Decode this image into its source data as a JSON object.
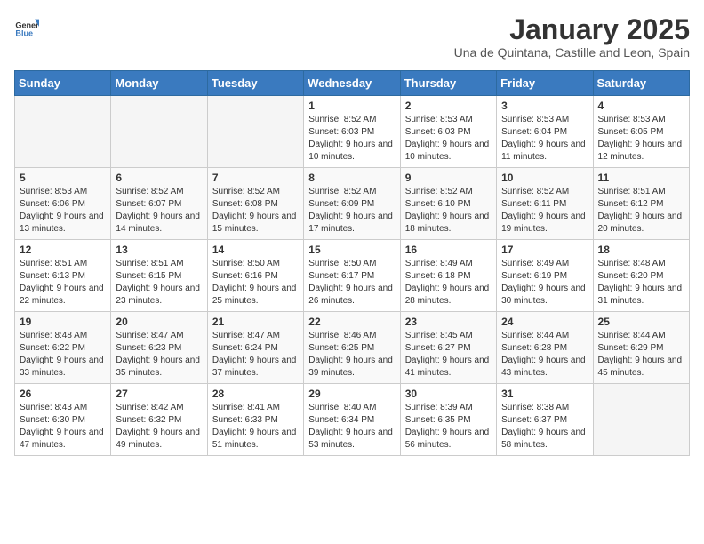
{
  "header": {
    "logo_general": "General",
    "logo_blue": "Blue",
    "title": "January 2025",
    "subtitle": "Una de Quintana, Castille and Leon, Spain"
  },
  "days_of_week": [
    "Sunday",
    "Monday",
    "Tuesday",
    "Wednesday",
    "Thursday",
    "Friday",
    "Saturday"
  ],
  "weeks": [
    [
      {
        "day": "",
        "info": ""
      },
      {
        "day": "",
        "info": ""
      },
      {
        "day": "",
        "info": ""
      },
      {
        "day": "1",
        "info": "Sunrise: 8:52 AM\nSunset: 6:03 PM\nDaylight: 9 hours and 10 minutes."
      },
      {
        "day": "2",
        "info": "Sunrise: 8:53 AM\nSunset: 6:03 PM\nDaylight: 9 hours and 10 minutes."
      },
      {
        "day": "3",
        "info": "Sunrise: 8:53 AM\nSunset: 6:04 PM\nDaylight: 9 hours and 11 minutes."
      },
      {
        "day": "4",
        "info": "Sunrise: 8:53 AM\nSunset: 6:05 PM\nDaylight: 9 hours and 12 minutes."
      }
    ],
    [
      {
        "day": "5",
        "info": "Sunrise: 8:53 AM\nSunset: 6:06 PM\nDaylight: 9 hours and 13 minutes."
      },
      {
        "day": "6",
        "info": "Sunrise: 8:52 AM\nSunset: 6:07 PM\nDaylight: 9 hours and 14 minutes."
      },
      {
        "day": "7",
        "info": "Sunrise: 8:52 AM\nSunset: 6:08 PM\nDaylight: 9 hours and 15 minutes."
      },
      {
        "day": "8",
        "info": "Sunrise: 8:52 AM\nSunset: 6:09 PM\nDaylight: 9 hours and 17 minutes."
      },
      {
        "day": "9",
        "info": "Sunrise: 8:52 AM\nSunset: 6:10 PM\nDaylight: 9 hours and 18 minutes."
      },
      {
        "day": "10",
        "info": "Sunrise: 8:52 AM\nSunset: 6:11 PM\nDaylight: 9 hours and 19 minutes."
      },
      {
        "day": "11",
        "info": "Sunrise: 8:51 AM\nSunset: 6:12 PM\nDaylight: 9 hours and 20 minutes."
      }
    ],
    [
      {
        "day": "12",
        "info": "Sunrise: 8:51 AM\nSunset: 6:13 PM\nDaylight: 9 hours and 22 minutes."
      },
      {
        "day": "13",
        "info": "Sunrise: 8:51 AM\nSunset: 6:15 PM\nDaylight: 9 hours and 23 minutes."
      },
      {
        "day": "14",
        "info": "Sunrise: 8:50 AM\nSunset: 6:16 PM\nDaylight: 9 hours and 25 minutes."
      },
      {
        "day": "15",
        "info": "Sunrise: 8:50 AM\nSunset: 6:17 PM\nDaylight: 9 hours and 26 minutes."
      },
      {
        "day": "16",
        "info": "Sunrise: 8:49 AM\nSunset: 6:18 PM\nDaylight: 9 hours and 28 minutes."
      },
      {
        "day": "17",
        "info": "Sunrise: 8:49 AM\nSunset: 6:19 PM\nDaylight: 9 hours and 30 minutes."
      },
      {
        "day": "18",
        "info": "Sunrise: 8:48 AM\nSunset: 6:20 PM\nDaylight: 9 hours and 31 minutes."
      }
    ],
    [
      {
        "day": "19",
        "info": "Sunrise: 8:48 AM\nSunset: 6:22 PM\nDaylight: 9 hours and 33 minutes."
      },
      {
        "day": "20",
        "info": "Sunrise: 8:47 AM\nSunset: 6:23 PM\nDaylight: 9 hours and 35 minutes."
      },
      {
        "day": "21",
        "info": "Sunrise: 8:47 AM\nSunset: 6:24 PM\nDaylight: 9 hours and 37 minutes."
      },
      {
        "day": "22",
        "info": "Sunrise: 8:46 AM\nSunset: 6:25 PM\nDaylight: 9 hours and 39 minutes."
      },
      {
        "day": "23",
        "info": "Sunrise: 8:45 AM\nSunset: 6:27 PM\nDaylight: 9 hours and 41 minutes."
      },
      {
        "day": "24",
        "info": "Sunrise: 8:44 AM\nSunset: 6:28 PM\nDaylight: 9 hours and 43 minutes."
      },
      {
        "day": "25",
        "info": "Sunrise: 8:44 AM\nSunset: 6:29 PM\nDaylight: 9 hours and 45 minutes."
      }
    ],
    [
      {
        "day": "26",
        "info": "Sunrise: 8:43 AM\nSunset: 6:30 PM\nDaylight: 9 hours and 47 minutes."
      },
      {
        "day": "27",
        "info": "Sunrise: 8:42 AM\nSunset: 6:32 PM\nDaylight: 9 hours and 49 minutes."
      },
      {
        "day": "28",
        "info": "Sunrise: 8:41 AM\nSunset: 6:33 PM\nDaylight: 9 hours and 51 minutes."
      },
      {
        "day": "29",
        "info": "Sunrise: 8:40 AM\nSunset: 6:34 PM\nDaylight: 9 hours and 53 minutes."
      },
      {
        "day": "30",
        "info": "Sunrise: 8:39 AM\nSunset: 6:35 PM\nDaylight: 9 hours and 56 minutes."
      },
      {
        "day": "31",
        "info": "Sunrise: 8:38 AM\nSunset: 6:37 PM\nDaylight: 9 hours and 58 minutes."
      },
      {
        "day": "",
        "info": ""
      }
    ]
  ]
}
